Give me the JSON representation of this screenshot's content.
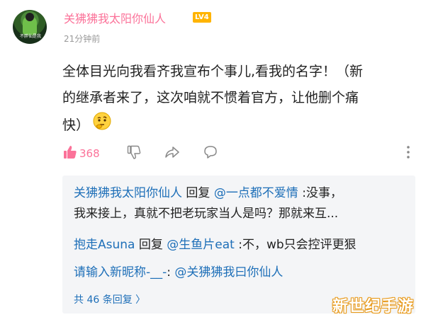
{
  "comment": {
    "avatar_text": "不胖仙是我",
    "username": "关狒狒我太阳你仙人",
    "level": "LV4",
    "time": "21分钟前",
    "text_line1": "全体目光向我看齐我宣布个事儿,看我的名字！（新",
    "text_line2": "的继承者来了，这次咱就不惯着官方，让他删个痛",
    "text_line3": "快）",
    "emoji_icon": "thinking-face-icon",
    "like_count": "368"
  },
  "replies": [
    {
      "author": "关狒狒我太阳你仙人",
      "verb": " 回复 ",
      "target": "@一点都不爱情",
      "text": " :没事，",
      "continuation": "我来接上，真就不把老玩家当人是吗？那就来互..."
    },
    {
      "author": "抱走Asuna",
      "verb": " 回复 ",
      "target": "@生鱼片eat",
      "text": " :不，wb只会控评更狠"
    },
    {
      "author": "请输入新昵称-__-",
      "verb": ": ",
      "target": "@关狒狒我曰你仙人",
      "text": ""
    }
  ],
  "more_replies": "共 46 条回复 〉",
  "watermark": "新世纪手游",
  "colors": {
    "pink": "#fb7299",
    "blue": "#1e6fb8",
    "gray": "#999999",
    "reply_bg": "#f4f5f7"
  }
}
